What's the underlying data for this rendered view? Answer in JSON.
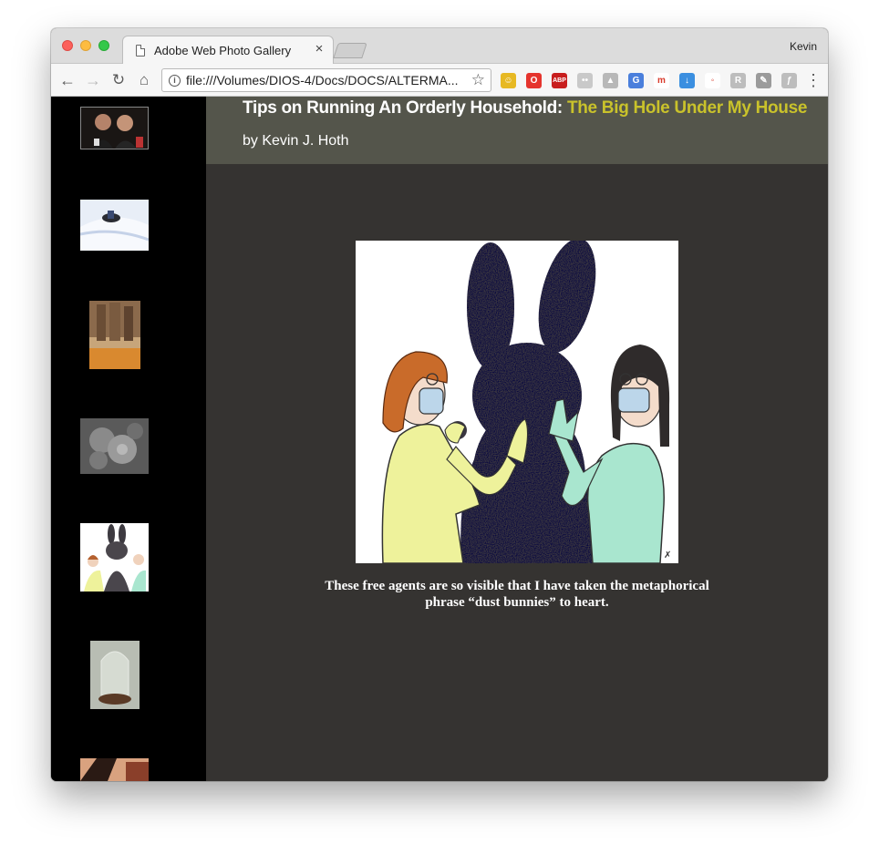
{
  "browser": {
    "tab_title": "Adobe Web Photo Gallery",
    "tab_close": "×",
    "profile_name": "Kevin",
    "url": "file:///Volumes/DIOS-4/Docs/DOCS/ALTERMA...",
    "nav": {
      "back": "←",
      "forward": "→",
      "reload": "↻",
      "home": "⌂",
      "star": "☆",
      "menu": "⋮",
      "info": "i"
    },
    "extensions": [
      {
        "name": "smiley-ext-icon",
        "glyph": "☺",
        "color": "#e7b923"
      },
      {
        "name": "opera-ext-icon",
        "glyph": "O",
        "color": "#e5342d"
      },
      {
        "name": "adblock-plus-icon",
        "glyph": "ABP",
        "color": "#c81e1e"
      },
      {
        "name": "flickr-ext-icon",
        "glyph": "••",
        "color": "#c9c9c9"
      },
      {
        "name": "drive-ext-icon",
        "glyph": "▲",
        "color": "#b8b8b8"
      },
      {
        "name": "translate-ext-icon",
        "glyph": "G",
        "color": "#4a7fdc"
      },
      {
        "name": "m-ext-icon",
        "glyph": "m",
        "color": "#ffffff"
      },
      {
        "name": "download-ext-icon",
        "glyph": "↓",
        "color": "#3b8fe0"
      },
      {
        "name": "cast-ext-icon",
        "glyph": "◦",
        "color": "#ffffff"
      },
      {
        "name": "r-ext-icon",
        "glyph": "R",
        "color": "#bdbdbd"
      },
      {
        "name": "tool-ext-icon",
        "glyph": "✎",
        "color": "#9b9b9b"
      },
      {
        "name": "flash-ext-icon",
        "glyph": "ƒ",
        "color": "#bdbdbd"
      }
    ]
  },
  "page": {
    "title_main": "Tips on Running An Orderly Household: ",
    "title_highlight": "The Big Hole Under My House",
    "byline": "by Kevin J. Hoth",
    "caption": "These free agents are so visible that I have taken the metaphorical phrase “dust bunnies” to heart.",
    "colors": {
      "sidebar": "#000000",
      "header": "#54554b",
      "content": "#353331",
      "highlight": "#c9c22b"
    }
  }
}
